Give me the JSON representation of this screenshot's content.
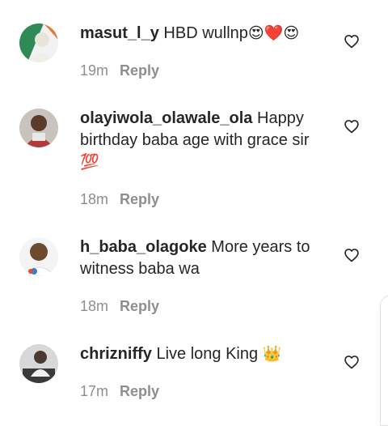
{
  "comments": [
    {
      "username": "masut_l_y",
      "text": "HBD wullnp",
      "emoji": "😍❤️😍",
      "time": "19m",
      "reply": "Reply",
      "avatar_icon": "avatar-photo-icon",
      "avatar_color": "#2e8b57"
    },
    {
      "username": "olayiwola_olawale_ola",
      "text": "Happy birthday baba age with grace sir",
      "emoji": "💯",
      "time": "18m",
      "reply": "Reply",
      "avatar_icon": "avatar-photo-icon",
      "avatar_color": "#b23a3a"
    },
    {
      "username": "h_baba_olagoke",
      "text": "More years to witness baba wa",
      "emoji": "",
      "time": "18m",
      "reply": "Reply",
      "avatar_icon": "avatar-photo-icon",
      "avatar_color": "#6b4a2e"
    },
    {
      "username": "chrizniffy",
      "text": "Live long King",
      "emoji": "👑",
      "time": "17m",
      "reply": "Reply",
      "avatar_icon": "avatar-photo-icon",
      "avatar_color": "#3a3a3a"
    }
  ],
  "colors": {
    "text": "#262626",
    "meta": "#8e8e8e",
    "heart_stroke": "#262626"
  },
  "icons": {
    "like": "heart-outline-icon"
  }
}
